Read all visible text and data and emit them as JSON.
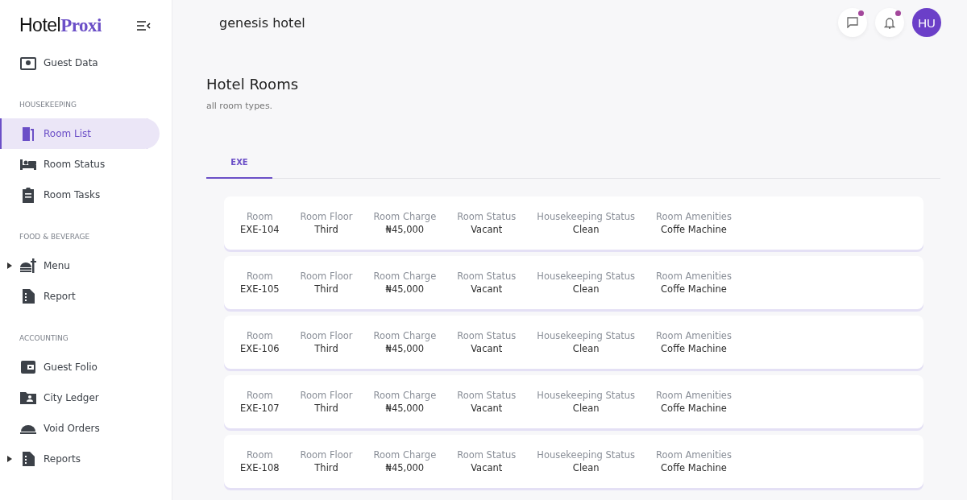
{
  "brand": {
    "part_1": "Hotel",
    "part_2": "Proxi"
  },
  "sidebar": {
    "sections": [
      {
        "items": [
          {
            "kind": "guest",
            "label": "Guest Data",
            "selected": false
          }
        ]
      },
      {
        "title": "HOUSEKEEPING",
        "items": [
          {
            "kind": "door",
            "label": "Room List",
            "selected": true
          },
          {
            "kind": "bed",
            "label": "Room Status",
            "selected": false
          },
          {
            "kind": "clipboard",
            "label": "Room Tasks",
            "selected": false
          }
        ]
      },
      {
        "title": "FOOD & BEVERAGE",
        "items": [
          {
            "kind": "food",
            "label": "Menu",
            "selected": false,
            "expanded": false
          },
          {
            "kind": "report",
            "label": "Report",
            "selected": false
          }
        ]
      },
      {
        "title": "ACCOUNTING",
        "items": [
          {
            "kind": "wallet",
            "label": "Guest Folio",
            "selected": false
          },
          {
            "kind": "folder",
            "label": "City Ledger",
            "selected": false
          },
          {
            "kind": "cloche",
            "label": "Void Orders",
            "selected": false
          },
          {
            "kind": "report",
            "label": "Reports",
            "selected": false,
            "expanded": false
          }
        ]
      }
    ]
  },
  "header": {
    "hotel": "genesis hotel",
    "avatar": "HU",
    "messages_unread": true,
    "notifications_unread": true
  },
  "page": {
    "title": "Hotel Rooms",
    "subtitle": "all room types."
  },
  "tabs": [
    {
      "label": "EXE",
      "selected": true
    }
  ],
  "rooms": [
    {
      "fields": [
        {
          "label": "Room",
          "value": "EXE-104"
        },
        {
          "label": "Room Floor",
          "value": "Third"
        },
        {
          "label": "Room Charge",
          "value": "₦45,000"
        },
        {
          "label": "Room Status",
          "value": "Vacant"
        },
        {
          "label": "Housekeeping Status",
          "value": "Clean"
        },
        {
          "label": "Room Amenities",
          "value": "Coffe Machine"
        }
      ]
    },
    {
      "fields": [
        {
          "label": "Room",
          "value": "EXE-105"
        },
        {
          "label": "Room Floor",
          "value": "Third"
        },
        {
          "label": "Room Charge",
          "value": "₦45,000"
        },
        {
          "label": "Room Status",
          "value": "Vacant"
        },
        {
          "label": "Housekeeping Status",
          "value": "Clean"
        },
        {
          "label": "Room Amenities",
          "value": "Coffe Machine"
        }
      ]
    },
    {
      "fields": [
        {
          "label": "Room",
          "value": "EXE-106"
        },
        {
          "label": "Room Floor",
          "value": "Third"
        },
        {
          "label": "Room Charge",
          "value": "₦45,000"
        },
        {
          "label": "Room Status",
          "value": "Vacant"
        },
        {
          "label": "Housekeeping Status",
          "value": "Clean"
        },
        {
          "label": "Room Amenities",
          "value": "Coffe Machine"
        }
      ]
    },
    {
      "fields": [
        {
          "label": "Room",
          "value": "EXE-107"
        },
        {
          "label": "Room Floor",
          "value": "Third"
        },
        {
          "label": "Room Charge",
          "value": "₦45,000"
        },
        {
          "label": "Room Status",
          "value": "Vacant"
        },
        {
          "label": "Housekeeping Status",
          "value": "Clean"
        },
        {
          "label": "Room Amenities",
          "value": "Coffe Machine"
        }
      ]
    },
    {
      "fields": [
        {
          "label": "Room",
          "value": "EXE-108"
        },
        {
          "label": "Room Floor",
          "value": "Third"
        },
        {
          "label": "Room Charge",
          "value": "₦45,000"
        },
        {
          "label": "Room Status",
          "value": "Vacant"
        },
        {
          "label": "Housekeeping Status",
          "value": "Clean"
        },
        {
          "label": "Room Amenities",
          "value": "Coffe Machine"
        }
      ]
    }
  ]
}
